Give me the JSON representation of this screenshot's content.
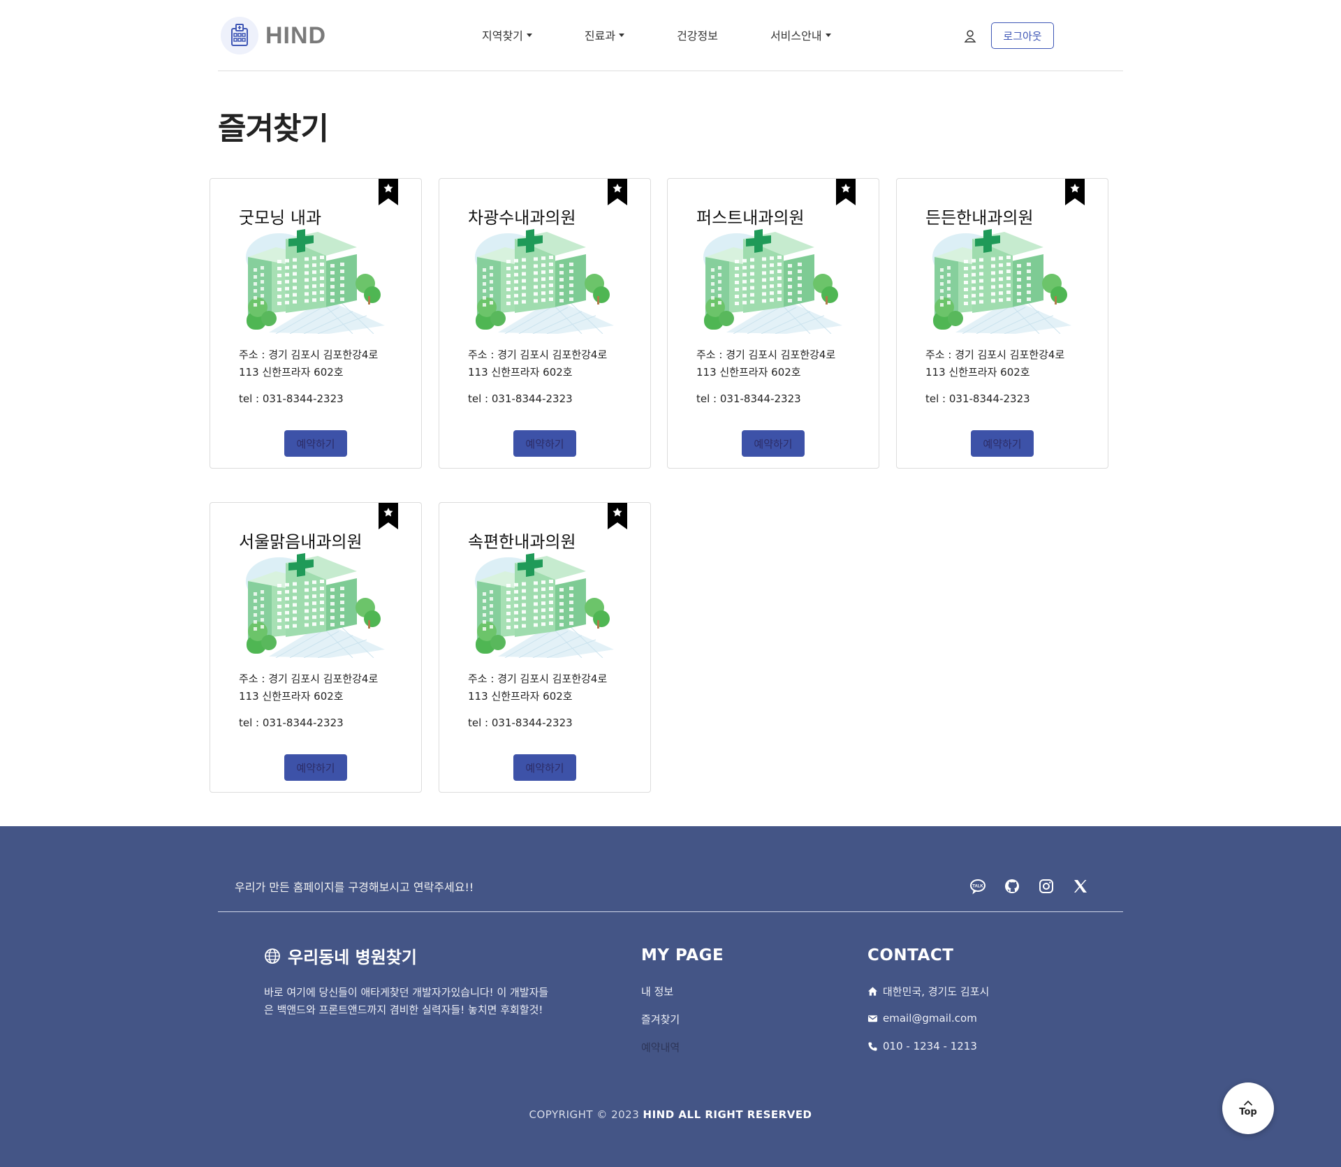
{
  "header": {
    "logo_text": "HIND",
    "nav": [
      {
        "label": "지역찾기",
        "has_dropdown": true
      },
      {
        "label": "진료과",
        "has_dropdown": true
      },
      {
        "label": "건강정보",
        "has_dropdown": false
      },
      {
        "label": "서비스안내",
        "has_dropdown": true
      }
    ],
    "user_icon": "user-icon",
    "logout_label": "로그아웃",
    "accent_color": "#3d55b5"
  },
  "page": {
    "title": "즐겨찾기"
  },
  "favorites": [
    {
      "name": "굿모닝 내과",
      "address": "주소 : 경기 김포시 김포한강4로 113 신한프라자 602호",
      "tel": "tel : 031-8344-2323",
      "button": "예약하기",
      "bookmarked": true
    },
    {
      "name": "차광수내과의원",
      "address": "주소 : 경기 김포시 김포한강4로 113 신한프라자 602호",
      "tel": "tel : 031-8344-2323",
      "button": "예약하기",
      "bookmarked": true
    },
    {
      "name": "퍼스트내과의원",
      "address": "주소 : 경기 김포시 김포한강4로 113 신한프라자 602호",
      "tel": "tel : 031-8344-2323",
      "button": "예약하기",
      "bookmarked": true
    },
    {
      "name": "든든한내과의원",
      "address": "주소 : 경기 김포시 김포한강4로 113 신한프라자 602호",
      "tel": "tel : 031-8344-2323",
      "button": "예약하기",
      "bookmarked": true
    },
    {
      "name": "서울맑음내과의원",
      "address": "주소 : 경기 김포시 김포한강4로 113 신한프라자 602호",
      "tel": "tel : 031-8344-2323",
      "button": "예약하기",
      "bookmarked": true
    },
    {
      "name": "속편한내과의원",
      "address": "주소 : 경기 김포시 김포한강4로 113 신한프라자 602호",
      "tel": "tel : 031-8344-2323",
      "button": "예약하기",
      "bookmarked": true
    }
  ],
  "footer": {
    "tagline": "우리가 만든 홈페이지를 구경해보시고 연락주세요!!",
    "social": [
      "kakaotalk-icon",
      "github-icon",
      "instagram-icon",
      "x-icon"
    ],
    "brand": {
      "title": "우리동네 병원찾기",
      "description": "바로 여기에 당신들이 애타게찾던 개발자가있습니다! 이 개발자들은 백앤드와 프론트앤드까지 겸비한 실력자들! 놓치면 후회할것!"
    },
    "mypage": {
      "title": "MY PAGE",
      "links": [
        "내 정보",
        "즐겨찾기",
        "예약내역"
      ]
    },
    "contact": {
      "title": "CONTACT",
      "address": "대한민국, 경기도 김포시",
      "email": "email@gmail.com",
      "phone": "010 - 1234 - 1213"
    },
    "copyright_prefix": "COPYRIGHT © 2023",
    "copyright_brand": "HIND ALL RIGHT RESERVED",
    "background_color": "#445586"
  },
  "top_button": {
    "label": "Top"
  }
}
